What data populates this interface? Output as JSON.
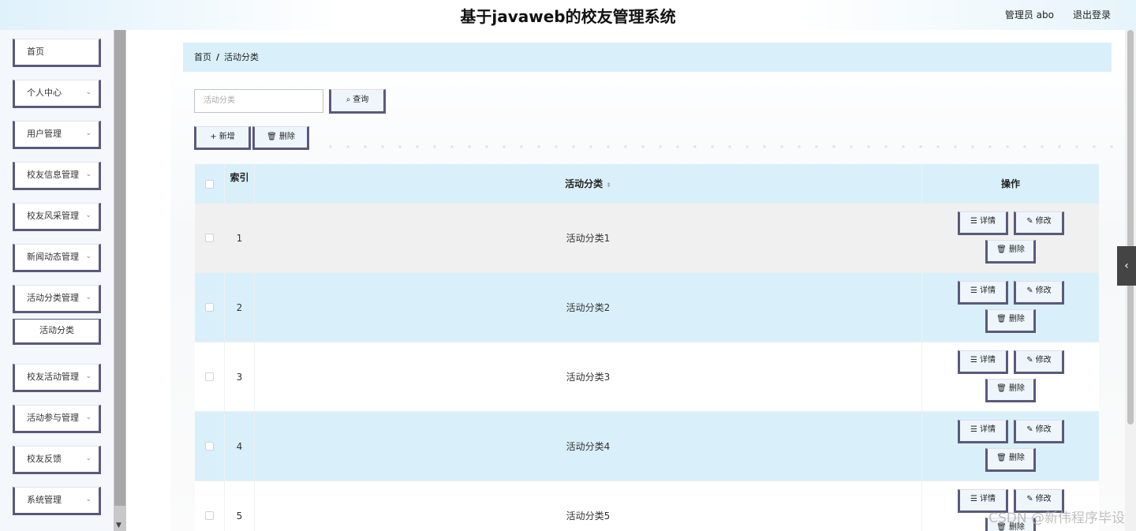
{
  "header": {
    "title": "基于javaweb的校友管理系统",
    "user": "管理员 abo",
    "logout": "退出登录"
  },
  "sidebar": {
    "items": [
      {
        "label": "首页",
        "chev": ""
      },
      {
        "label": "个人中心",
        "chev": "⌄"
      },
      {
        "label": "用户管理",
        "chev": "⌄"
      },
      {
        "label": "校友信息管理",
        "chev": "⌄"
      },
      {
        "label": "校友风采管理",
        "chev": "⌄"
      },
      {
        "label": "新闻动态管理",
        "chev": "⌄"
      },
      {
        "label": "活动分类管理",
        "chev": "⌄"
      },
      {
        "label": "活动分类",
        "chev": ""
      },
      {
        "label": "校友活动管理",
        "chev": "⌄"
      },
      {
        "label": "活动参与管理",
        "chev": "⌄"
      },
      {
        "label": "校友反馈",
        "chev": "⌄"
      },
      {
        "label": "系统管理",
        "chev": "⌄"
      }
    ]
  },
  "breadcrumb": {
    "home": "首页",
    "sep": "/",
    "current": "活动分类"
  },
  "search": {
    "placeholder": "活动分类",
    "button": "查询"
  },
  "toolbar": {
    "add": "新增",
    "delete": "删除"
  },
  "table": {
    "headers": {
      "index": "索引",
      "name": "活动分类",
      "ops": "操作"
    },
    "rows": [
      {
        "index": "1",
        "name": "活动分类1"
      },
      {
        "index": "2",
        "name": "活动分类2"
      },
      {
        "index": "3",
        "name": "活动分类3"
      },
      {
        "index": "4",
        "name": "活动分类4"
      },
      {
        "index": "5",
        "name": "活动分类5"
      }
    ],
    "op_labels": {
      "detail": "详情",
      "edit": "修改",
      "delete": "删除"
    }
  },
  "watermark": "CSDN @新伟程序毕设",
  "icons": {
    "search": "search-icon",
    "plus": "plus-icon",
    "trash": "trash-icon",
    "doc": "document-icon",
    "pencil": "pencil-icon"
  }
}
